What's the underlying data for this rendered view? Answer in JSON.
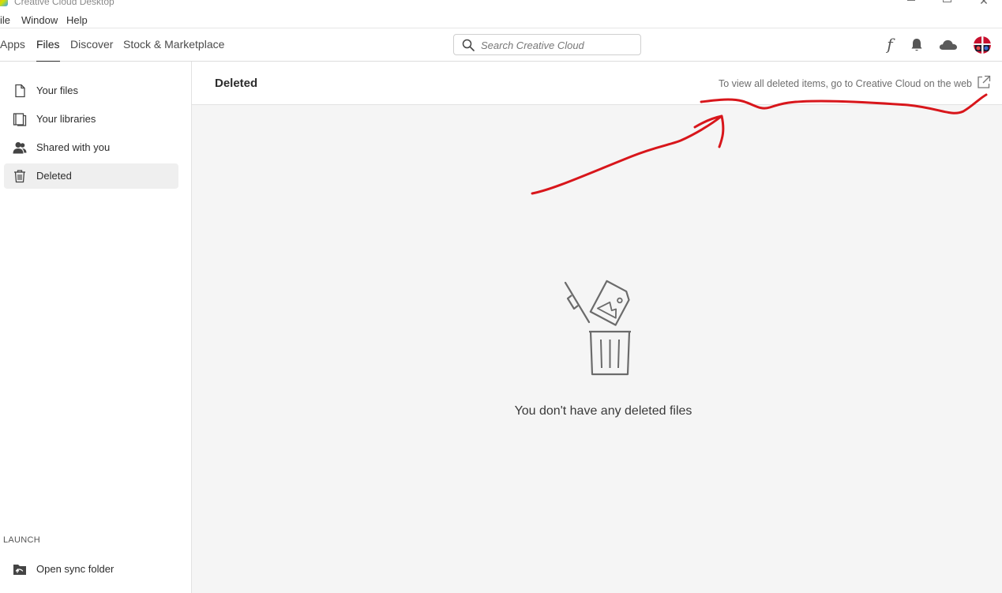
{
  "window": {
    "title": "Creative Cloud Desktop",
    "close_glyph": "✕"
  },
  "menu": {
    "items": [
      "ile",
      "Window",
      "Help"
    ]
  },
  "nav": {
    "tabs": [
      {
        "label": "Apps",
        "active": false
      },
      {
        "label": "Files",
        "active": true
      },
      {
        "label": "Discover",
        "active": false
      },
      {
        "label": "Stock & Marketplace",
        "active": false
      }
    ],
    "search_placeholder": "Search Creative Cloud",
    "icons": [
      "fonts-icon",
      "bell-icon",
      "cloud-icon",
      "avatar"
    ],
    "fonts_glyph": "f"
  },
  "sidebar": {
    "items": [
      {
        "label": "Your files",
        "icon": "file-icon",
        "active": false
      },
      {
        "label": "Your libraries",
        "icon": "libraries-icon",
        "active": false
      },
      {
        "label": "Shared with you",
        "icon": "people-icon",
        "active": false
      },
      {
        "label": "Deleted",
        "icon": "trash-icon",
        "active": true
      }
    ],
    "launch_heading": "LAUNCH",
    "launch_items": [
      {
        "label": "Open sync folder",
        "icon": "folder-sync-icon"
      }
    ]
  },
  "main": {
    "title": "Deleted",
    "web_link": "To view all deleted items, go to Creative Cloud on the web",
    "empty_message": "You don't have any deleted files"
  },
  "colors": {
    "accent": "#2c2c2c",
    "annotation": "#d8161b",
    "content_bg": "#f5f5f5",
    "active_item_bg": "#efefef"
  }
}
